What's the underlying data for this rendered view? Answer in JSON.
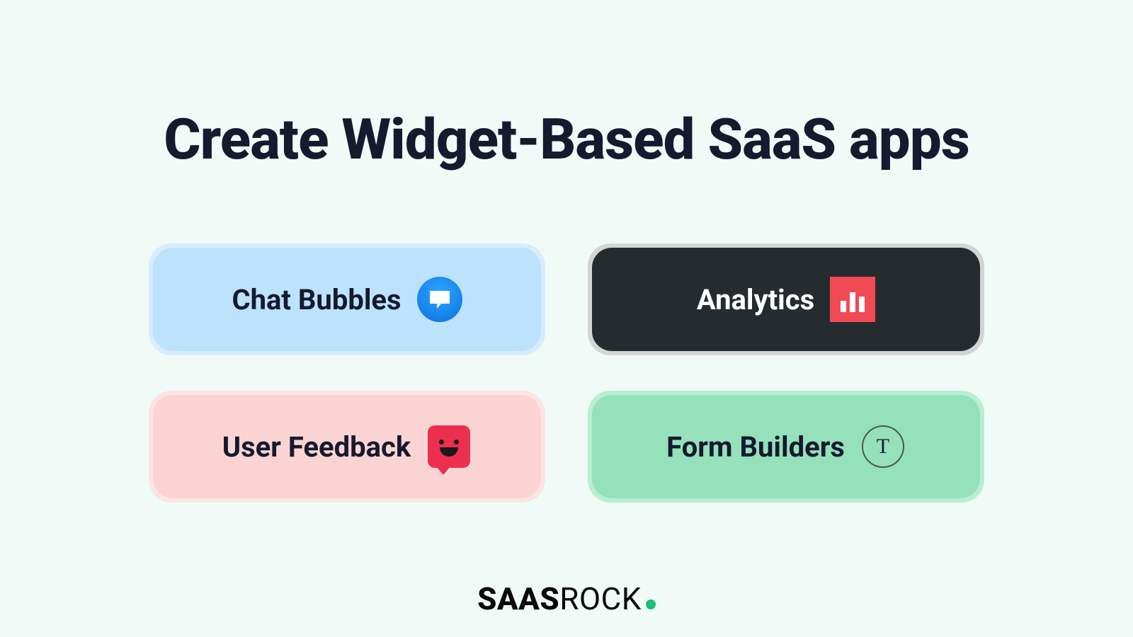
{
  "title": "Create Widget-Based SaaS apps",
  "cards": {
    "chat": {
      "label": "Chat Bubbles"
    },
    "analytics": {
      "label": "Analytics"
    },
    "feedback": {
      "label": "User Feedback"
    },
    "form": {
      "label": "Form Builders",
      "icon_letter": "T"
    }
  },
  "brand": {
    "part1": "SAAS",
    "part2": "ROCK"
  }
}
